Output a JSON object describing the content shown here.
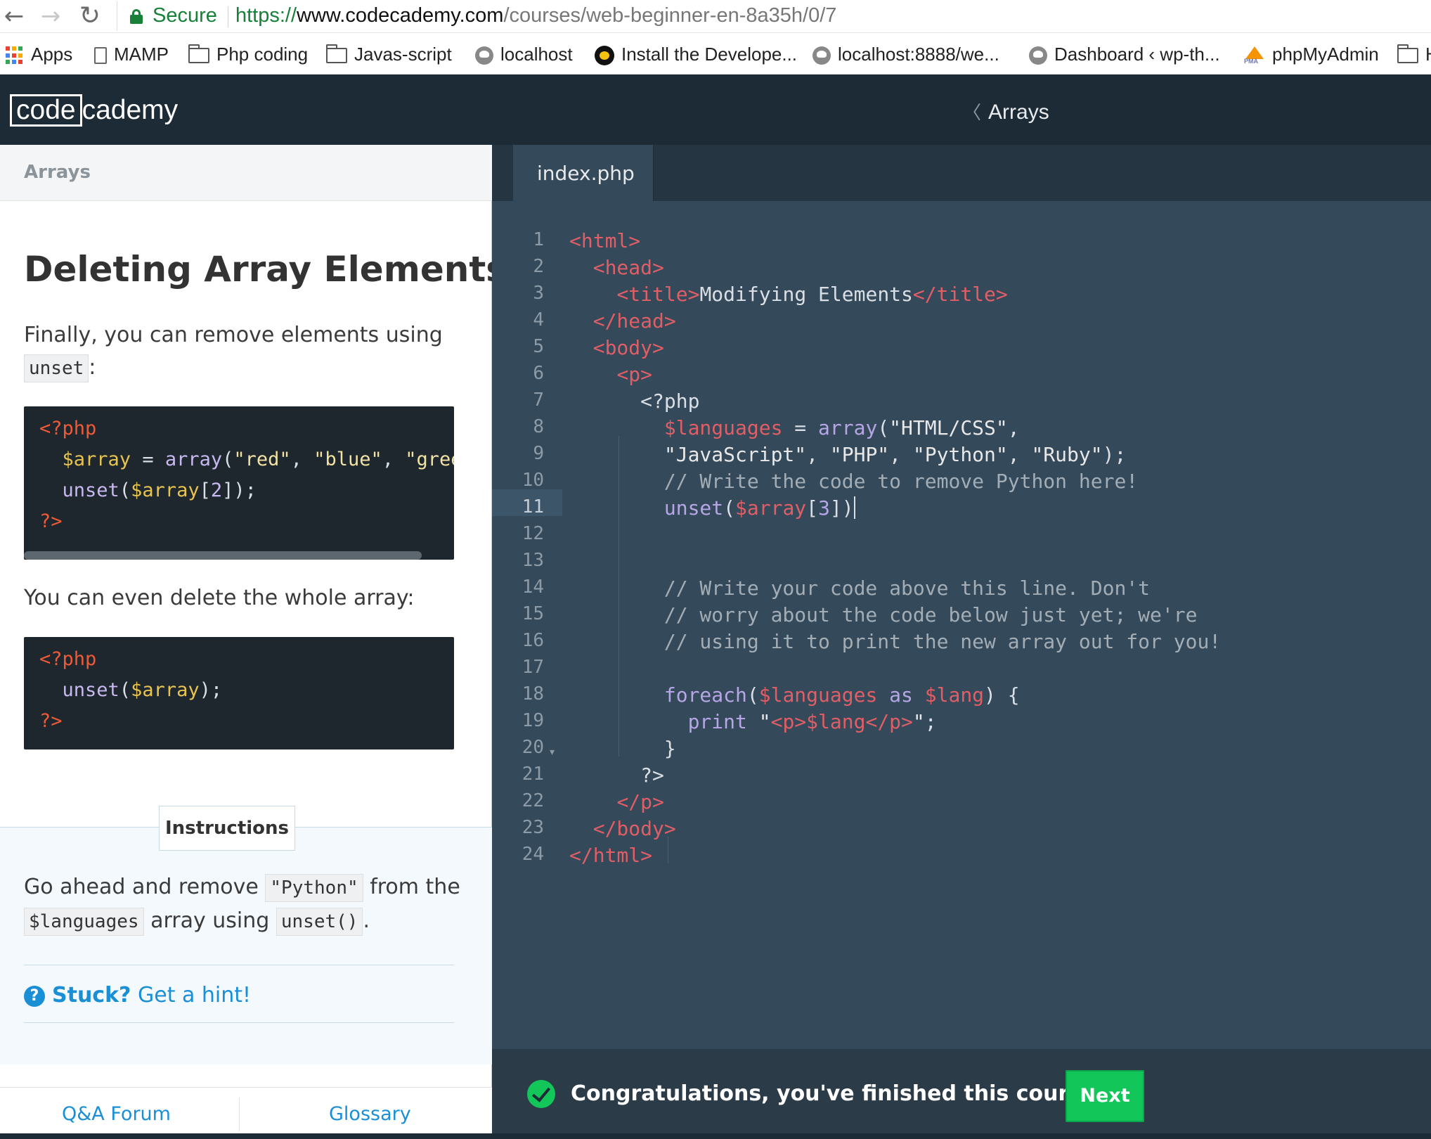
{
  "browser": {
    "secure_label": "Secure",
    "url_scheme": "https://",
    "url_host": "www.codecademy.com",
    "url_path": "/courses/web-beginner-en-8a35h/0/7",
    "bookmarks": [
      {
        "label": "Apps",
        "icon": "apps-grid-icon"
      },
      {
        "label": "MAMP",
        "icon": "page-icon"
      },
      {
        "label": "Php coding",
        "icon": "folder-icon"
      },
      {
        "label": "Javas-script",
        "icon": "folder-icon"
      },
      {
        "label": "localhost",
        "icon": "globe-icon"
      },
      {
        "label": "Install the Develope...",
        "icon": "linux-icon"
      },
      {
        "label": "localhost:8888/we...",
        "icon": "globe-icon"
      },
      {
        "label": "Dashboard ‹ wp-th...",
        "icon": "globe-icon"
      },
      {
        "label": "phpMyAdmin",
        "icon": "phpmyadmin-icon"
      },
      {
        "label": "H",
        "icon": "folder-icon"
      }
    ]
  },
  "header": {
    "logo_code": "code",
    "logo_cademy": "cademy",
    "breadcrumb": "Arrays"
  },
  "lesson": {
    "tab_label": "Arrays",
    "title": "Deleting Array Elements",
    "para1_text": "Finally, you can remove elements using",
    "para1_code": "unset",
    "para1_end": ":",
    "snippet1": [
      "<?php",
      "  $array = array(\"red\", \"blue\", \"green\"",
      "  unset($array[2]);",
      "?>"
    ],
    "para2_text": "You can even delete the whole array:",
    "snippet2": [
      "<?php",
      "  unset($array);",
      "?>"
    ],
    "instructions_tab": "Instructions",
    "instr_1": "Go ahead and remove",
    "instr_code1": "\"Python\"",
    "instr_2": "from the",
    "instr_code2": "$languages",
    "instr_3": "array using",
    "instr_code3": "unset()",
    "instr_4": ".",
    "hint_stuck": "Stuck?",
    "hint_get": "Get a hint!",
    "footer_qa": "Q&A Forum",
    "footer_glossary": "Glossary"
  },
  "editor": {
    "file_tab": "index.php",
    "current_line": 11,
    "line_count": 24
  },
  "bottom": {
    "congrats": "Congratulations, you've finished this course!",
    "next_label": "Next"
  }
}
